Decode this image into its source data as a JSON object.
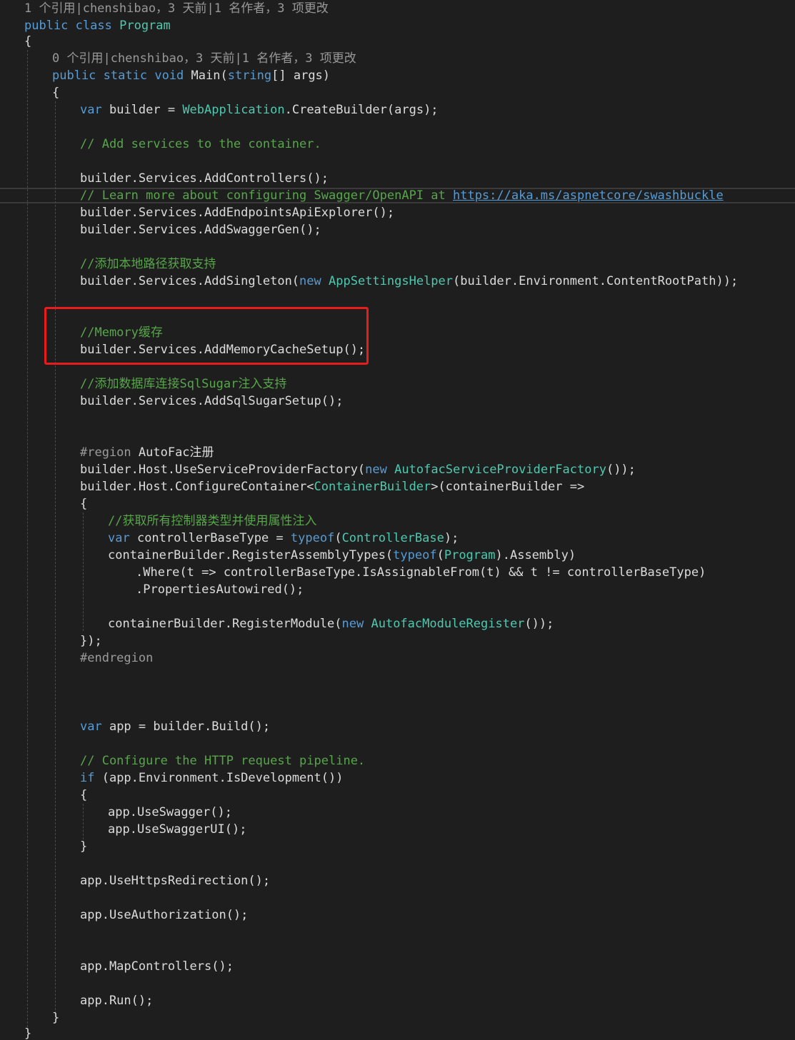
{
  "lens_class": "1 个引用|chenshibao，3 天前|1 名作者，3 项更改",
  "lens_main": "0 个引用|chenshibao，3 天前|1 名作者，3 项更改",
  "lines": [
    [
      [
        "kw",
        "public"
      ],
      [
        "pl",
        " "
      ],
      [
        "kw",
        "class"
      ],
      [
        "pl",
        " "
      ],
      [
        "ty",
        "Program"
      ]
    ],
    [
      [
        "pl",
        "{"
      ]
    ],
    [
      [
        "kw",
        "public"
      ],
      [
        "pl",
        " "
      ],
      [
        "kw",
        "static"
      ],
      [
        "pl",
        " "
      ],
      [
        "kw",
        "void"
      ],
      [
        "pl",
        " Main("
      ],
      [
        "kw",
        "string"
      ],
      [
        "pl",
        "[] args)"
      ]
    ],
    [
      [
        "pl",
        "{"
      ]
    ],
    [
      [
        "kw",
        "var"
      ],
      [
        "pl",
        " builder = "
      ],
      [
        "ty",
        "WebApplication"
      ],
      [
        "pl",
        ".CreateBuilder(args);"
      ]
    ],
    [
      [
        "cm",
        "// Add services to the container."
      ]
    ],
    [
      [
        "pl",
        "builder.Services.AddControllers();"
      ]
    ],
    [
      [
        "cm",
        "// Learn more about configuring Swagger/OpenAPI at "
      ],
      [
        "ln",
        "https://aka.ms/aspnetcore/swashbuckle"
      ]
    ],
    [
      [
        "pl",
        "builder.Services.AddEndpointsApiExplorer();"
      ]
    ],
    [
      [
        "pl",
        "builder.Services.AddSwaggerGen();"
      ]
    ],
    [
      [
        "cm",
        "//添加本地路径获取支持"
      ]
    ],
    [
      [
        "pl",
        "builder.Services.AddSingleton("
      ],
      [
        "kw",
        "new"
      ],
      [
        "pl",
        " "
      ],
      [
        "ty",
        "AppSettingsHelper"
      ],
      [
        "pl",
        "(builder.Environment.ContentRootPath));"
      ]
    ],
    [
      [
        "cm",
        "//Memory缓存"
      ]
    ],
    [
      [
        "pl",
        "builder.Services.AddMemoryCacheSetup();"
      ]
    ],
    [
      [
        "cm",
        "//添加数据库连接SqlSugar注入支持"
      ]
    ],
    [
      [
        "pl",
        "builder.Services.AddSqlSugarSetup();"
      ]
    ],
    [
      [
        "pp",
        "#region"
      ],
      [
        "pl",
        " AutoFac注册"
      ]
    ],
    [
      [
        "pl",
        "builder.Host.UseServiceProviderFactory("
      ],
      [
        "kw",
        "new"
      ],
      [
        "pl",
        " "
      ],
      [
        "ty",
        "AutofacServiceProviderFactory"
      ],
      [
        "pl",
        "());"
      ]
    ],
    [
      [
        "pl",
        "builder.Host.ConfigureContainer<"
      ],
      [
        "ty",
        "ContainerBuilder"
      ],
      [
        "pl",
        ">(containerBuilder =>"
      ]
    ],
    [
      [
        "pl",
        "{"
      ]
    ],
    [
      [
        "cm",
        "//获取所有控制器类型并使用属性注入"
      ]
    ],
    [
      [
        "kw",
        "var"
      ],
      [
        "pl",
        " controllerBaseType = "
      ],
      [
        "kw",
        "typeof"
      ],
      [
        "pl",
        "("
      ],
      [
        "ty",
        "ControllerBase"
      ],
      [
        "pl",
        ");"
      ]
    ],
    [
      [
        "pl",
        "containerBuilder.RegisterAssemblyTypes("
      ],
      [
        "kw",
        "typeof"
      ],
      [
        "pl",
        "("
      ],
      [
        "ty",
        "Program"
      ],
      [
        "pl",
        ").Assembly)"
      ]
    ],
    [
      [
        "pl",
        ".Where(t => controllerBaseType.IsAssignableFrom(t) && t != controllerBaseType)"
      ]
    ],
    [
      [
        "pl",
        ".PropertiesAutowired();"
      ]
    ],
    [
      [
        "pl",
        "containerBuilder.RegisterModule("
      ],
      [
        "kw",
        "new"
      ],
      [
        "pl",
        " "
      ],
      [
        "ty",
        "AutofacModuleRegister"
      ],
      [
        "pl",
        "());"
      ]
    ],
    [
      [
        "pl",
        "});"
      ]
    ],
    [
      [
        "pp",
        "#endregion"
      ]
    ],
    [
      [
        "kw",
        "var"
      ],
      [
        "pl",
        " app = builder.Build();"
      ]
    ],
    [
      [
        "cm",
        "// Configure the HTTP request pipeline."
      ]
    ],
    [
      [
        "kw",
        "if"
      ],
      [
        "pl",
        " (app.Environment.IsDevelopment())"
      ]
    ],
    [
      [
        "pl",
        "{"
      ]
    ],
    [
      [
        "pl",
        "app.UseSwagger();"
      ]
    ],
    [
      [
        "pl",
        "app.UseSwaggerUI();"
      ]
    ],
    [
      [
        "pl",
        "}"
      ]
    ],
    [
      [
        "pl",
        "app.UseHttpsRedirection();"
      ]
    ],
    [
      [
        "pl",
        "app.UseAuthorization();"
      ]
    ],
    [
      [
        "pl",
        "app.MapControllers();"
      ]
    ],
    [
      [
        "pl",
        "app.Run();"
      ]
    ],
    [
      [
        "pl",
        "}"
      ]
    ],
    [
      [
        "pl",
        "}"
      ]
    ]
  ]
}
